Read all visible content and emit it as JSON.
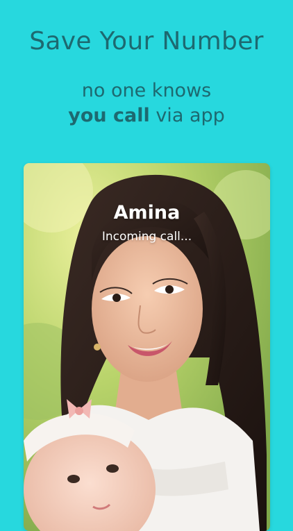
{
  "promo": {
    "headline": "Save Your Number",
    "line1": "no one knows",
    "line2_strong": "you call",
    "line2_rest": " via app"
  },
  "call_screen": {
    "caller_name": "Amina",
    "status": "Incoming call..."
  },
  "colors": {
    "background": "#27d8de",
    "text": "#1d6970",
    "overlay_text": "#ffffff"
  }
}
